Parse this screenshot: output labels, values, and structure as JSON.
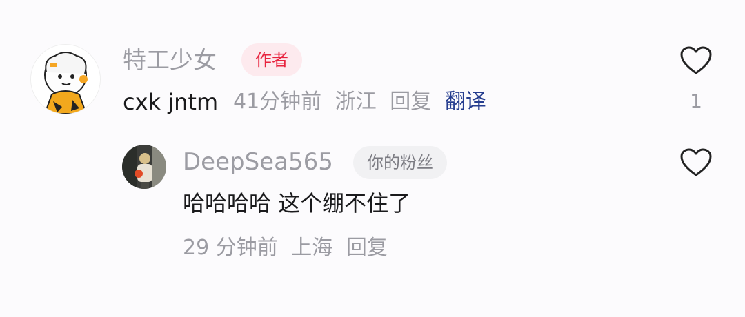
{
  "comment": {
    "username": "特工少女",
    "badge": "作者",
    "text": "cxk jntm",
    "time": "41分钟前",
    "location": "浙江",
    "reply": "回复",
    "translate": "翻译",
    "likes": "1",
    "like_icon": "heart-outline-icon"
  },
  "reply_comment": {
    "username": "DeepSea565",
    "badge": "你的粉丝",
    "text": "哈哈哈哈 这个绷不住了",
    "time": "29 分钟前",
    "location": "上海",
    "reply": "回复",
    "likes": "",
    "like_icon": "heart-outline-icon"
  },
  "colors": {
    "author_badge_bg": "#fdeaee",
    "author_badge_text": "#e8243f",
    "translate_link": "#253d8f"
  }
}
